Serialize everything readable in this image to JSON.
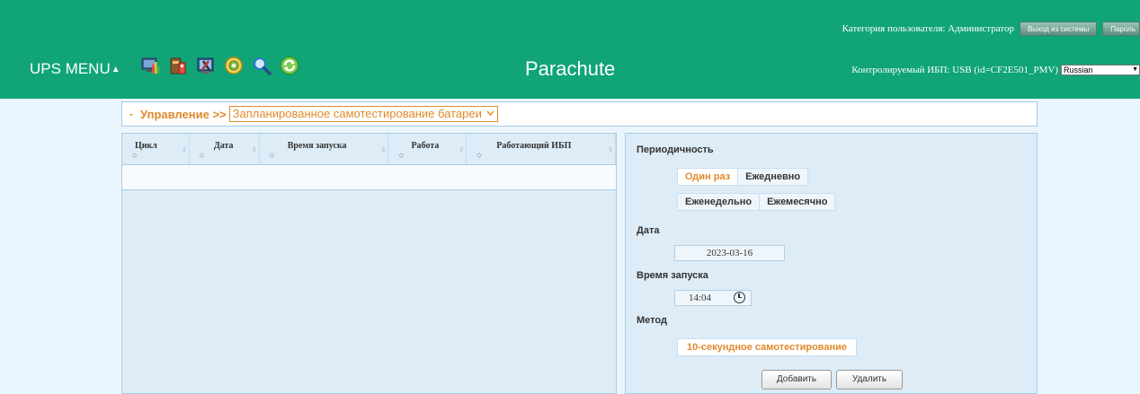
{
  "header": {
    "user_category": "Категория пользователя: Администратор",
    "logout_label": "Выход из системы",
    "password_label": "Пароль",
    "menu_label": "UPS MENU",
    "menu_arrow": "▲",
    "brand": "Parachute",
    "monitored_ups": "Контролируемый ИБП: USB (id=CF2E501_PMV)",
    "language": "Russian",
    "toolbar_icons": [
      "monitor-chart-icon",
      "ups-battery-icon",
      "tools-icon",
      "settings-disc-icon",
      "search-icon",
      "refresh-icon"
    ]
  },
  "breadcrumb": {
    "dash": "-",
    "section": "Управление >>",
    "page": "Запланированное самотестирование батареи"
  },
  "table": {
    "columns": [
      "Цикл",
      "Дата",
      "Время запуска",
      "Работа",
      "Работающий ИБП"
    ],
    "rows": []
  },
  "form": {
    "periodicity_label": "Периодичность",
    "periodicity_options": [
      "Один раз",
      "Ежедневно",
      "Еженедельно",
      "Ежемесячно"
    ],
    "periodicity_selected": "Один раз",
    "date_label": "Дата",
    "date_value": "2023-03-16",
    "time_label": "Время запуска",
    "time_value": "14:04",
    "method_label": "Метод",
    "method_value": "10-секундное самотестирование",
    "add_label": "Добавить",
    "delete_label": "Удалить"
  },
  "colors": {
    "header_green": "#10a477",
    "accent_orange": "#e08a2c",
    "panel_blue": "#ddecf7"
  }
}
